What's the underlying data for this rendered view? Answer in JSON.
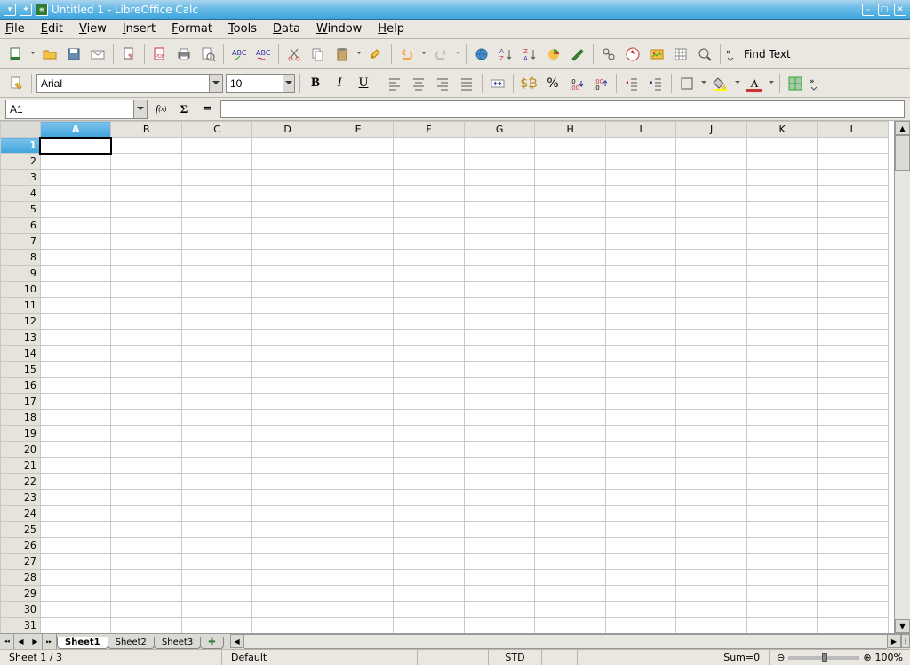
{
  "title": "Untitled 1 - LibreOffice Calc",
  "menu": [
    "File",
    "Edit",
    "View",
    "Insert",
    "Format",
    "Tools",
    "Data",
    "Window",
    "Help"
  ],
  "find_text": "Find Text",
  "font_name": "Arial",
  "font_size": "10",
  "cell_ref": "A1",
  "columns": [
    "A",
    "B",
    "C",
    "D",
    "E",
    "F",
    "G",
    "H",
    "I",
    "J",
    "K",
    "L"
  ],
  "row_count": 32,
  "selected_col": "A",
  "selected_row": 1,
  "tabs": [
    "Sheet1",
    "Sheet2",
    "Sheet3"
  ],
  "active_tab": 0,
  "status": {
    "sheet": "Sheet 1 / 3",
    "style": "Default",
    "mode": "STD",
    "sum": "Sum=0",
    "zoom": "100%"
  }
}
